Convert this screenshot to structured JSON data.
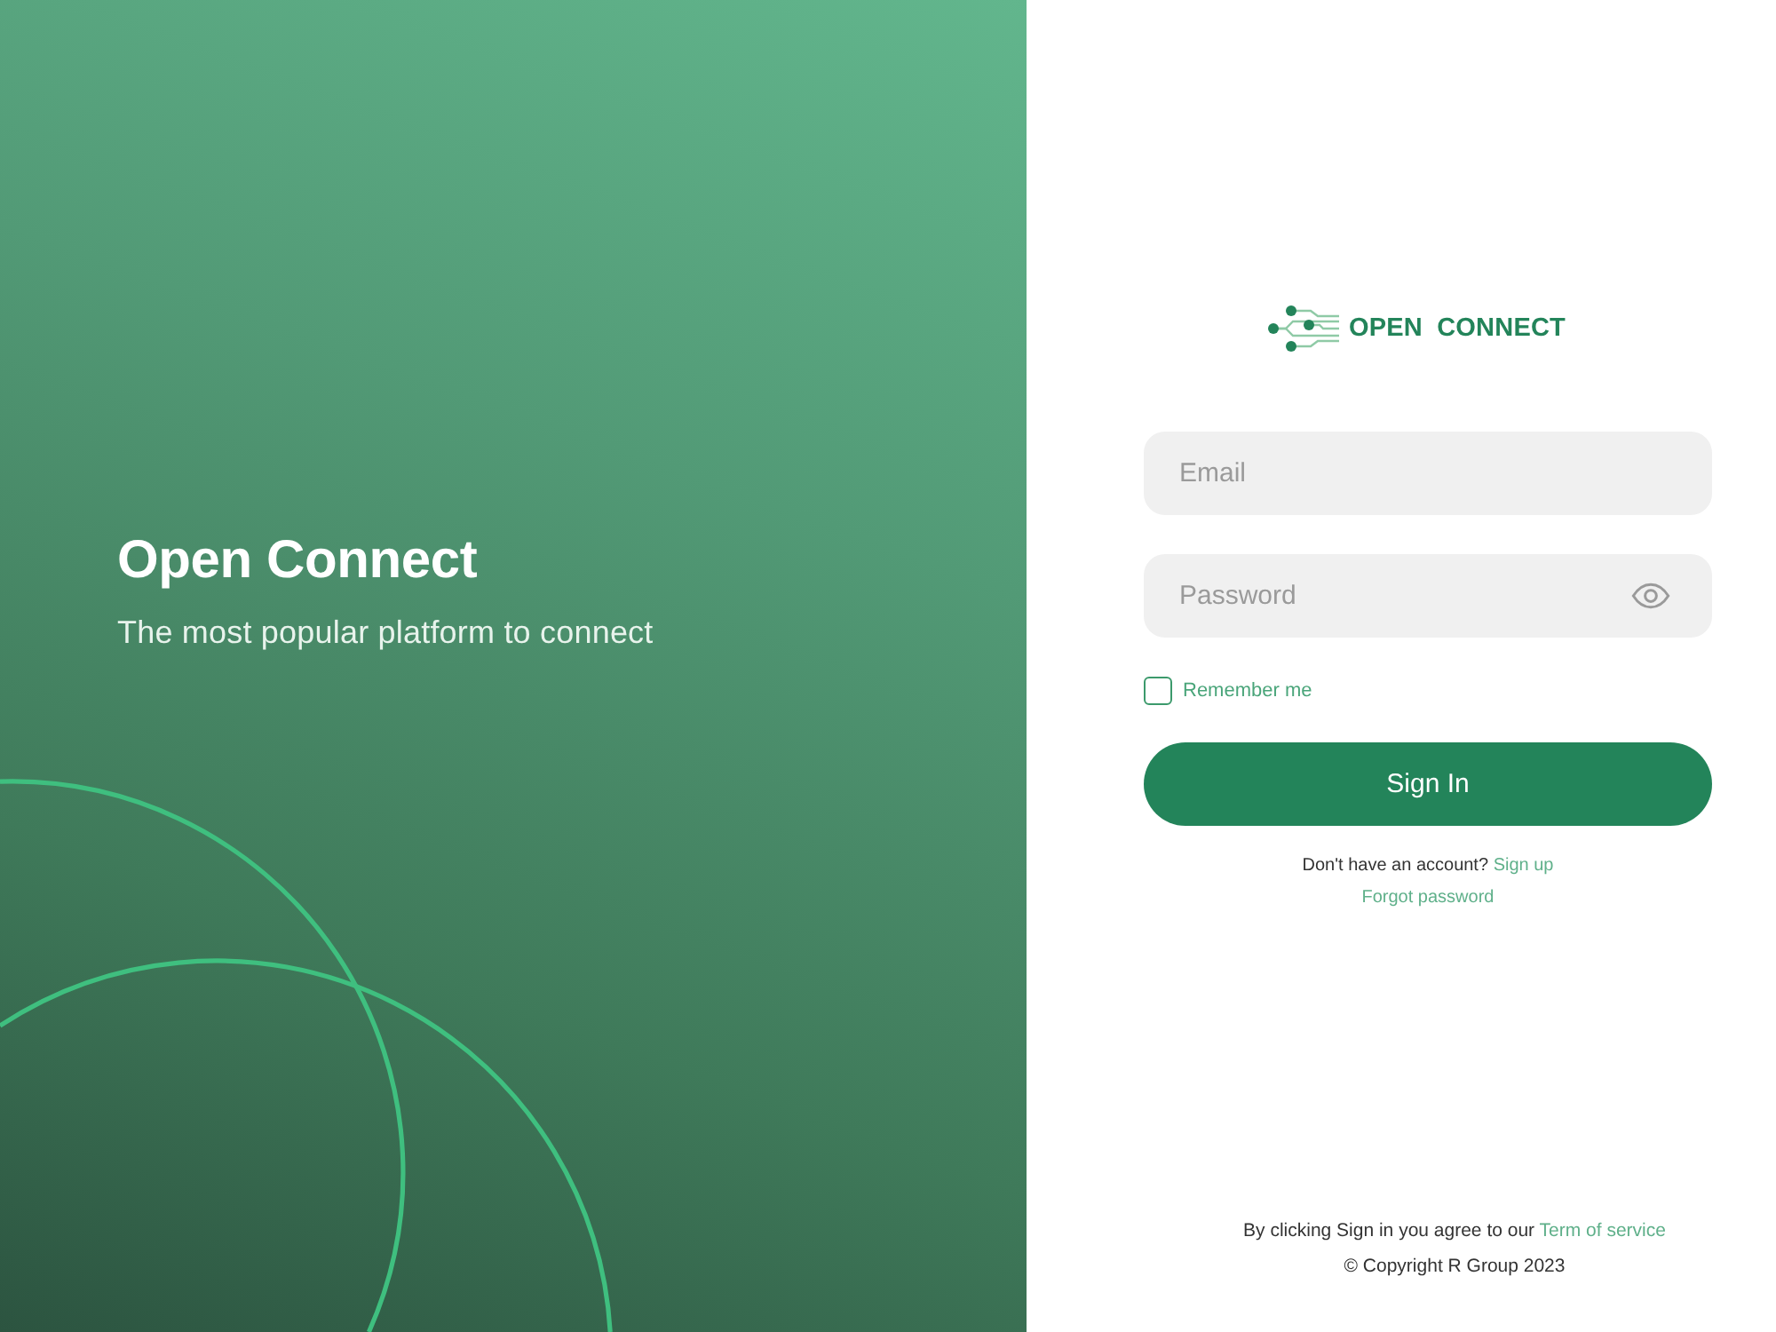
{
  "hero": {
    "title": "Open Connect",
    "subtitle": "The most popular platform to connect"
  },
  "logo": {
    "text": "OPEN CONNECT"
  },
  "form": {
    "email": {
      "placeholder": "Email"
    },
    "password": {
      "placeholder": "Password"
    },
    "remember": {
      "label": "Remember me",
      "checked": false
    },
    "submit": "Sign In",
    "signup_prompt": "Don't have an account?",
    "signup_link": "Sign up",
    "forgot_link": "Forgot password"
  },
  "footer": {
    "terms_text": "By clicking Sign in you agree to our",
    "terms_link": "Term of service",
    "copyright": "© Copyright R Group 2023"
  }
}
